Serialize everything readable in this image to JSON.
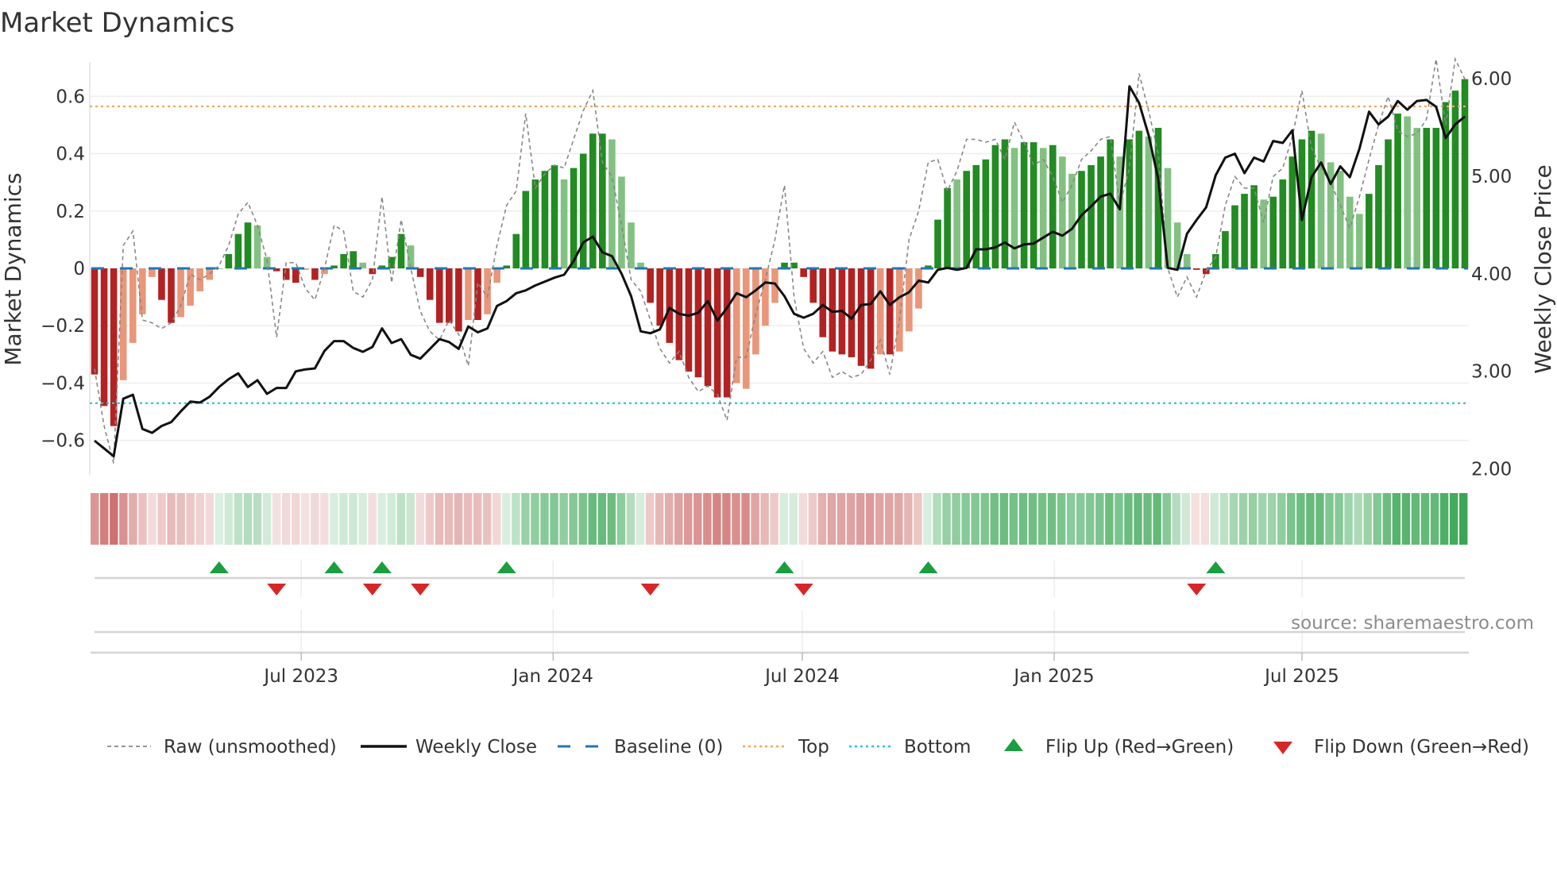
{
  "title": "Market Dynamics",
  "source": "source: sharemaestro.com",
  "chart_data": {
    "type": "bar",
    "title": "Market Dynamics",
    "ylabel": "Market Dynamics",
    "y2label": "Weekly Close Price",
    "frequency": "weekly",
    "start_date": "2023-01-31",
    "ylim": [
      -0.72,
      0.72
    ],
    "y2lim": [
      1.94,
      6.17
    ],
    "yticks": [
      {
        "v": 0.6,
        "label": "0.6"
      },
      {
        "v": 0.4,
        "label": "0.4"
      },
      {
        "v": 0.2,
        "label": "0.2"
      },
      {
        "v": 0,
        "label": "0"
      },
      {
        "v": -0.2,
        "label": "−0.2"
      },
      {
        "v": -0.4,
        "label": "−0.4"
      },
      {
        "v": -0.6,
        "label": "−0.6"
      }
    ],
    "y2ticks": [
      {
        "v": 6,
        "label": "6.00"
      },
      {
        "v": 5,
        "label": "5.00"
      },
      {
        "v": 4,
        "label": "4.00"
      },
      {
        "v": 3,
        "label": "3.00"
      },
      {
        "v": 2,
        "label": "2.00"
      }
    ],
    "xticks": [
      {
        "date": "2023-07-01",
        "label": "Jul 2023"
      },
      {
        "date": "2024-01-01",
        "label": "Jan 2024"
      },
      {
        "date": "2024-07-01",
        "label": "Jul 2024"
      },
      {
        "date": "2025-01-01",
        "label": "Jan 2025"
      },
      {
        "date": "2025-07-01",
        "label": "Jul 2025"
      }
    ],
    "grid": true,
    "top_level": 0.565,
    "bottom_level": -0.47,
    "baseline": 0,
    "dynamics": [
      -0.37,
      -0.48,
      -0.55,
      -0.39,
      -0.26,
      -0.16,
      -0.03,
      -0.11,
      -0.19,
      -0.17,
      -0.13,
      -0.08,
      -0.04,
      0,
      0.05,
      0.12,
      0.16,
      0.15,
      0.04,
      -0.01,
      -0.04,
      -0.05,
      -0.005,
      -0.04,
      -0.02,
      0.01,
      0.05,
      0.06,
      0.02,
      -0.02,
      0.01,
      0.04,
      0.12,
      0.08,
      -0.03,
      -0.11,
      -0.19,
      -0.19,
      -0.22,
      -0.18,
      -0.18,
      -0.16,
      -0.05,
      0.01,
      0.12,
      0.27,
      0.31,
      0.34,
      0.36,
      0.31,
      0.35,
      0.4,
      0.47,
      0.47,
      0.45,
      0.32,
      0.16,
      0.02,
      -0.12,
      -0.2,
      -0.26,
      -0.32,
      -0.36,
      -0.38,
      -0.41,
      -0.45,
      -0.45,
      -0.4,
      -0.42,
      -0.3,
      -0.2,
      -0.12,
      0.02,
      0.02,
      -0.03,
      -0.12,
      -0.24,
      -0.29,
      -0.3,
      -0.31,
      -0.34,
      -0.35,
      -0.3,
      -0.3,
      -0.29,
      -0.22,
      -0.14,
      0.01,
      0.17,
      0.28,
      0.31,
      0.34,
      0.36,
      0.38,
      0.43,
      0.45,
      0.42,
      0.44,
      0.44,
      0.42,
      0.43,
      0.39,
      0.33,
      0.34,
      0.36,
      0.39,
      0.45,
      0.39,
      0.45,
      0.48,
      0.46,
      0.49,
      0.35,
      0.16,
      0.05,
      -0.005,
      -0.02,
      0.05,
      0.13,
      0.22,
      0.26,
      0.29,
      0.24,
      0.25,
      0.31,
      0.39,
      0.45,
      0.48,
      0.47,
      0.37,
      0.34,
      0.25,
      0.19,
      0.26,
      0.36,
      0.45,
      0.54,
      0.53,
      0.49,
      0.49,
      0.49,
      0.58,
      0.62,
      0.66
    ],
    "strengthening": [
      1,
      1,
      1,
      0,
      0,
      0,
      0,
      1,
      1,
      0,
      0,
      0,
      0,
      0,
      1,
      1,
      1,
      0,
      0,
      1,
      1,
      1,
      0,
      1,
      0,
      1,
      1,
      1,
      0,
      1,
      1,
      1,
      1,
      0,
      1,
      1,
      1,
      1,
      1,
      0,
      1,
      0,
      0,
      1,
      1,
      1,
      1,
      1,
      1,
      0,
      1,
      1,
      1,
      1,
      0,
      0,
      0,
      0,
      1,
      1,
      1,
      1,
      1,
      1,
      1,
      1,
      1,
      0,
      0,
      0,
      0,
      0,
      1,
      1,
      1,
      1,
      1,
      1,
      1,
      1,
      1,
      1,
      0,
      1,
      0,
      0,
      0,
      1,
      1,
      1,
      0,
      1,
      1,
      1,
      1,
      1,
      0,
      1,
      1,
      0,
      1,
      0,
      0,
      1,
      1,
      1,
      1,
      0,
      1,
      1,
      0,
      1,
      0,
      0,
      0,
      1,
      1,
      1,
      1,
      1,
      1,
      1,
      0,
      1,
      1,
      1,
      1,
      1,
      0,
      0,
      0,
      0,
      0,
      1,
      1,
      1,
      1,
      0,
      0,
      1,
      1,
      1,
      1,
      1
    ],
    "raw": [
      -0.35,
      -0.55,
      -0.68,
      0.08,
      0.13,
      -0.18,
      -0.19,
      -0.21,
      -0.19,
      -0.13,
      -0.02,
      -0.04,
      -0.02,
      0.01,
      0.08,
      0.19,
      0.23,
      0.15,
      0.03,
      -0.24,
      0.02,
      0.02,
      -0.07,
      -0.11,
      0.0,
      0.15,
      0.13,
      -0.08,
      -0.1,
      -0.04,
      0.25,
      -0.05,
      0.17,
      0.0,
      -0.15,
      -0.22,
      -0.25,
      -0.18,
      -0.23,
      -0.34,
      -0.05,
      -0.1,
      0.08,
      0.22,
      0.27,
      0.54,
      0.28,
      0.33,
      0.36,
      0.35,
      0.45,
      0.55,
      0.62,
      0.37,
      0.32,
      0.15,
      -0.04,
      -0.08,
      -0.18,
      -0.28,
      -0.33,
      -0.29,
      -0.38,
      -0.43,
      -0.41,
      -0.44,
      -0.53,
      -0.31,
      -0.31,
      -0.16,
      -0.04,
      0.1,
      0.29,
      -0.1,
      -0.28,
      -0.33,
      -0.29,
      -0.38,
      -0.36,
      -0.38,
      -0.37,
      -0.32,
      -0.25,
      -0.37,
      -0.18,
      0.1,
      0.2,
      0.37,
      0.38,
      0.27,
      0.34,
      0.45,
      0.45,
      0.44,
      0.45,
      0.38,
      0.51,
      0.44,
      0.36,
      0.38,
      0.32,
      0.23,
      0.29,
      0.38,
      0.41,
      0.45,
      0.46,
      0.22,
      0.35,
      0.68,
      0.55,
      0.4,
      0.0,
      -0.1,
      -0.03,
      -0.1,
      -0.01,
      0.04,
      0.22,
      0.32,
      0.28,
      0.28,
      0.16,
      0.32,
      0.35,
      0.46,
      0.62,
      0.42,
      0.35,
      0.3,
      0.22,
      0.14,
      0.25,
      0.38,
      0.5,
      0.6,
      0.48,
      0.46,
      0.47,
      0.52,
      0.73,
      0.5,
      0.73,
      0.66
    ],
    "weekly_close": [
      2.29,
      2.21,
      2.13,
      2.72,
      2.76,
      2.41,
      2.37,
      2.44,
      2.48,
      2.59,
      2.69,
      2.68,
      2.74,
      2.84,
      2.92,
      2.98,
      2.84,
      2.91,
      2.77,
      2.83,
      2.83,
      3.0,
      3.02,
      3.03,
      3.21,
      3.31,
      3.31,
      3.24,
      3.2,
      3.25,
      3.44,
      3.29,
      3.33,
      3.17,
      3.13,
      3.23,
      3.33,
      3.3,
      3.23,
      3.46,
      3.4,
      3.44,
      3.67,
      3.72,
      3.8,
      3.83,
      3.88,
      3.92,
      3.96,
      3.99,
      4.13,
      4.32,
      4.38,
      4.22,
      4.18,
      4.0,
      3.77,
      3.41,
      3.39,
      3.43,
      3.65,
      3.59,
      3.57,
      3.6,
      3.72,
      3.52,
      3.65,
      3.8,
      3.76,
      3.83,
      3.91,
      3.9,
      3.77,
      3.59,
      3.55,
      3.59,
      3.68,
      3.61,
      3.62,
      3.54,
      3.68,
      3.69,
      3.82,
      3.68,
      3.76,
      3.81,
      3.93,
      3.91,
      4.04,
      4.06,
      4.04,
      4.06,
      4.25,
      4.25,
      4.27,
      4.32,
      4.26,
      4.3,
      4.31,
      4.37,
      4.43,
      4.39,
      4.46,
      4.6,
      4.69,
      4.79,
      4.82,
      4.66,
      5.92,
      5.75,
      5.42,
      4.97,
      4.06,
      4.04,
      4.41,
      4.55,
      4.68,
      5.01,
      5.19,
      5.23,
      5.03,
      5.19,
      5.15,
      5.36,
      5.34,
      5.47,
      4.55,
      4.99,
      5.14,
      4.92,
      5.1,
      4.99,
      5.28,
      5.66,
      5.53,
      5.61,
      5.77,
      5.68,
      5.77,
      5.78,
      5.71,
      5.39,
      5.53,
      5.61
    ],
    "signals": [
      {
        "type": "up",
        "date": "2023-05-02"
      },
      {
        "type": "up",
        "date": "2023-07-25"
      },
      {
        "type": "up",
        "date": "2023-08-29"
      },
      {
        "type": "up",
        "date": "2023-11-28"
      },
      {
        "type": "up",
        "date": "2024-06-18"
      },
      {
        "type": "up",
        "date": "2024-10-01"
      },
      {
        "type": "up",
        "date": "2025-04-29"
      },
      {
        "type": "down",
        "date": "2023-06-13"
      },
      {
        "type": "down",
        "date": "2023-08-22"
      },
      {
        "type": "down",
        "date": "2023-09-26"
      },
      {
        "type": "down",
        "date": "2024-03-12"
      },
      {
        "type": "down",
        "date": "2024-07-02"
      },
      {
        "type": "down",
        "date": "2025-04-15"
      }
    ],
    "legend": {
      "placement": "bottom",
      "items": [
        {
          "key": "raw",
          "label": "Raw (unsmoothed)"
        },
        {
          "key": "close",
          "label": "Weekly Close"
        },
        {
          "key": "baseline",
          "label": "Baseline (0)"
        },
        {
          "key": "top",
          "label": "Top"
        },
        {
          "key": "bottom",
          "label": "Bottom"
        },
        {
          "key": "flip_up",
          "label": "Flip Up (Red→Green)"
        },
        {
          "key": "flip_down",
          "label": "Flip Down (Green→Red)"
        }
      ]
    },
    "colors": {
      "green_strong": "#228b22",
      "green_weak": "#82c182",
      "red_strong": "#b22222",
      "red_weak": "#e9967a",
      "close": "#111111",
      "raw": "#888888",
      "baseline": "#1f77b4",
      "top": "#f0a860",
      "bottom": "#2ec4d6",
      "flip_up": "#1a9e3f",
      "flip_down": "#d62728",
      "strip_green": "#3aa655",
      "strip_red": "#c85a5a"
    }
  }
}
